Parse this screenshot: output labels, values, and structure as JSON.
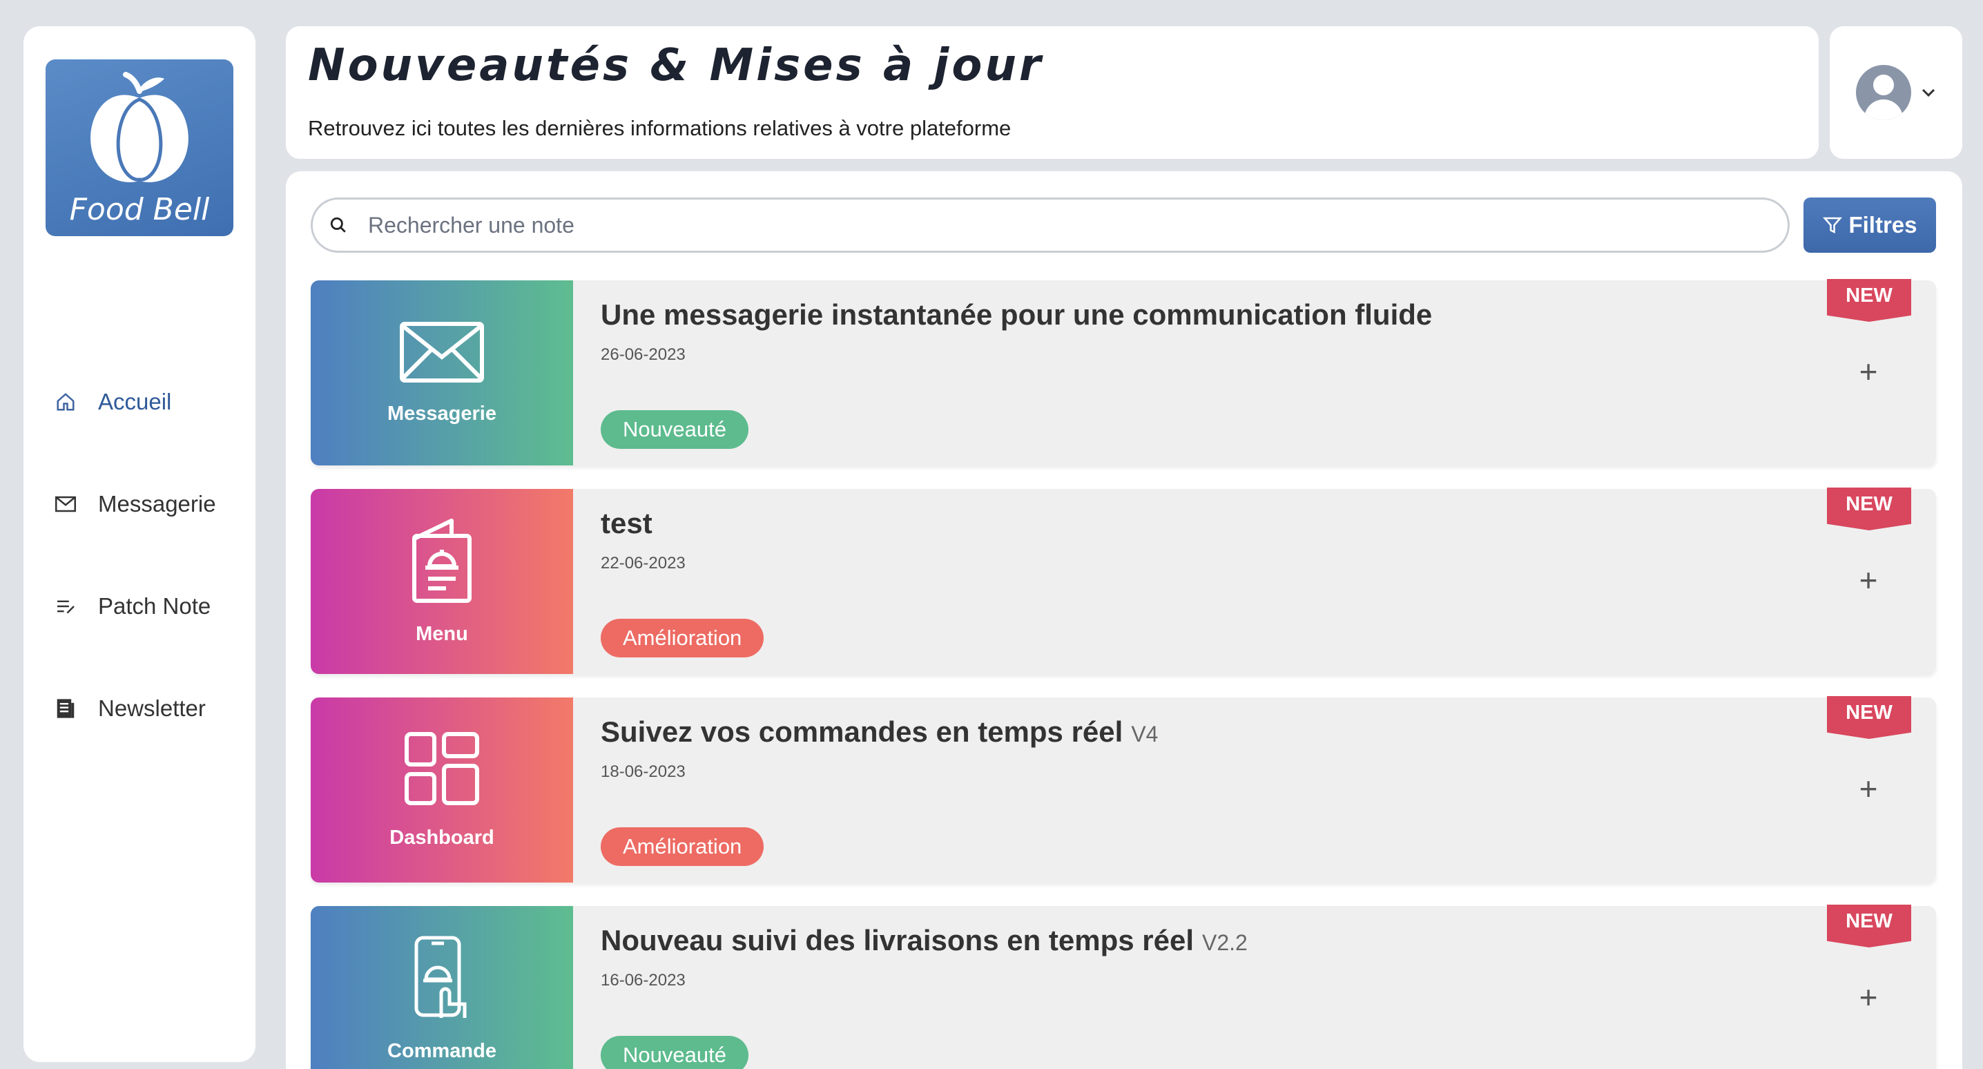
{
  "brand": {
    "name": "Food Bell"
  },
  "sidebar": {
    "items": [
      {
        "label": "Accueil",
        "icon": "home-icon",
        "active": true
      },
      {
        "label": "Messagerie",
        "icon": "envelope-icon"
      },
      {
        "label": "Patch Note",
        "icon": "notes-icon"
      },
      {
        "label": "Newsletter",
        "icon": "newspaper-icon"
      }
    ]
  },
  "header": {
    "title": "Nouveautés & Mises à jour",
    "subtitle": "Retrouvez ici toutes les dernières informations relatives à votre plateforme"
  },
  "search": {
    "placeholder": "Rechercher une note"
  },
  "filters": {
    "label": "Filtres"
  },
  "colors": {
    "accent": "#3d68a9",
    "tag_new_feature": "#5dbb8e",
    "tag_improvement": "#ed6b63",
    "ribbon": "#d8475e"
  },
  "notes": [
    {
      "category": "Messagerie",
      "icon": "envelope-icon",
      "title": "Une messagerie instantanée pour une communication fluide",
      "version": "",
      "date": "26-06-2023",
      "tag": "Nouveauté",
      "badge": "NEW"
    },
    {
      "category": "Menu",
      "icon": "menu-cloche-icon",
      "title": "test",
      "version": "",
      "date": "22-06-2023",
      "tag": "Amélioration",
      "badge": "NEW"
    },
    {
      "category": "Dashboard",
      "icon": "dashboard-grid-icon",
      "title": "Suivez vos commandes en temps réel",
      "version": "V4",
      "date": "18-06-2023",
      "tag": "Amélioration",
      "badge": "NEW"
    },
    {
      "category": "Commande",
      "icon": "phone-order-icon",
      "title": "Nouveau suivi des livraisons en temps réel",
      "version": "V2.2",
      "date": "16-06-2023",
      "tag": "Nouveauté",
      "badge": "NEW"
    }
  ]
}
